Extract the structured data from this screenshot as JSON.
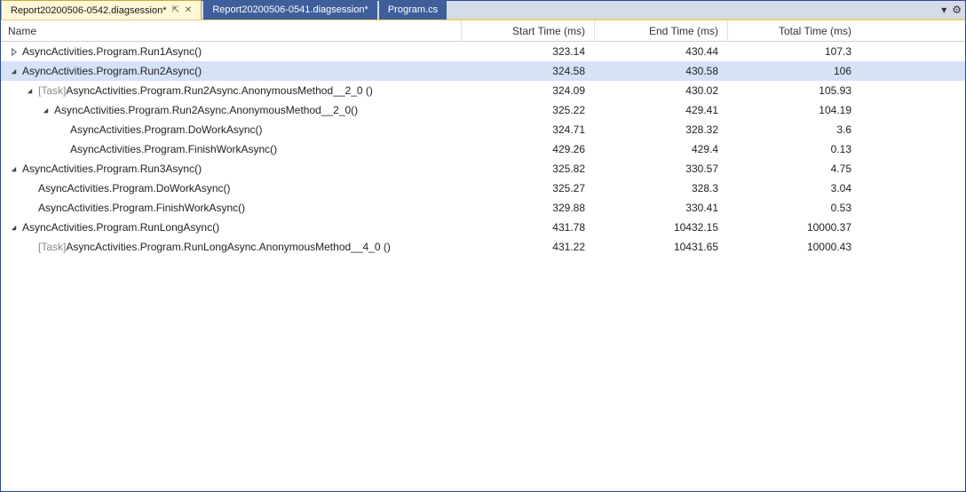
{
  "tabs": [
    {
      "label": "Report20200506-0542.diagsession*",
      "active": true,
      "pinned": true,
      "close": true
    },
    {
      "label": "Report20200506-0541.diagsession*",
      "active": false
    },
    {
      "label": "Program.cs",
      "active": false
    }
  ],
  "columns": {
    "name": "Name",
    "start": "Start Time (ms)",
    "end": "End Time (ms)",
    "total": "Total Time (ms)"
  },
  "rows": [
    {
      "indent": 0,
      "expander": "closed",
      "name": "AsyncActivities.Program.Run1Async()",
      "start": "323.14",
      "end": "430.44",
      "total": "107.3"
    },
    {
      "indent": 0,
      "expander": "open",
      "name": "AsyncActivities.Program.Run2Async()",
      "start": "324.58",
      "end": "430.58",
      "total": "106",
      "selected": true
    },
    {
      "indent": 1,
      "expander": "open",
      "task": true,
      "name": "AsyncActivities.Program.Run2Async.AnonymousMethod__2_0 ()",
      "start": "324.09",
      "end": "430.02",
      "total": "105.93"
    },
    {
      "indent": 2,
      "expander": "open",
      "name": "AsyncActivities.Program.Run2Async.AnonymousMethod__2_0()",
      "start": "325.22",
      "end": "429.41",
      "total": "104.19"
    },
    {
      "indent": 3,
      "expander": "none",
      "name": "AsyncActivities.Program.DoWorkAsync()",
      "start": "324.71",
      "end": "328.32",
      "total": "3.6"
    },
    {
      "indent": 3,
      "expander": "none",
      "name": "AsyncActivities.Program.FinishWorkAsync()",
      "start": "429.26",
      "end": "429.4",
      "total": "0.13"
    },
    {
      "indent": 0,
      "expander": "open",
      "name": "AsyncActivities.Program.Run3Async()",
      "start": "325.82",
      "end": "330.57",
      "total": "4.75"
    },
    {
      "indent": 1,
      "expander": "none",
      "name": "AsyncActivities.Program.DoWorkAsync()",
      "start": "325.27",
      "end": "328.3",
      "total": "3.04"
    },
    {
      "indent": 1,
      "expander": "none",
      "name": "AsyncActivities.Program.FinishWorkAsync()",
      "start": "329.88",
      "end": "330.41",
      "total": "0.53"
    },
    {
      "indent": 0,
      "expander": "open",
      "name": "AsyncActivities.Program.RunLongAsync()",
      "start": "431.78",
      "end": "10432.15",
      "total": "10000.37"
    },
    {
      "indent": 1,
      "expander": "none",
      "task": true,
      "name": "AsyncActivities.Program.RunLongAsync.AnonymousMethod__4_0 ()",
      "start": "431.22",
      "end": "10431.65",
      "total": "10000.43"
    }
  ],
  "taskPrefix": "[Task] "
}
